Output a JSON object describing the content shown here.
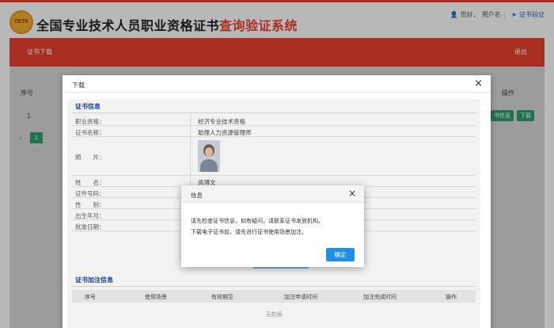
{
  "header": {
    "logo_text": "ПҞТК",
    "title_black": "全国专业技术人员职业资格证书",
    "title_red": "查询验证系统",
    "greeting": "您好，",
    "username": "用户名",
    "separator": "|",
    "verify_link": "证书验证"
  },
  "nav": {
    "left_item": "证书下载",
    "right_item": "退出"
  },
  "background_table": {
    "columns": [
      "序号",
      "操作"
    ],
    "row_number": "1",
    "buttons": [
      "书信息",
      "下载"
    ],
    "pager": {
      "prev": "‹",
      "current_page": "1"
    }
  },
  "dialog": {
    "title": "下载",
    "close": "×",
    "cert_section_title": "证书信息",
    "fields": [
      {
        "label": "职业资格：",
        "value": "经济专业技术资格"
      },
      {
        "label": "证书名称：",
        "value": "助理人力资源管理师"
      },
      {
        "label": "照　　片：",
        "value": ""
      },
      {
        "label": "姓　　名：",
        "value": "高博文"
      },
      {
        "label": "证件号码：",
        "value": ""
      },
      {
        "label": "性　　别：",
        "value": ""
      },
      {
        "label": "出生年月：",
        "value": ""
      },
      {
        "label": "批准日期：",
        "value": ""
      }
    ],
    "remark_section_title": "证书加注信息",
    "remark_columns": [
      "序号",
      "使用场景",
      "有效期至",
      "加注申请时间",
      "加注完成时间",
      "操作"
    ],
    "empty_text": "无数据"
  },
  "alert": {
    "title": "信息",
    "close": "×",
    "line1": "请先检查证书信息，如有疑问，请联系证书发放机构。",
    "line2": "下载电子证书前，请先进行证书使用场景加注。",
    "ok_label": "确定"
  },
  "colors": {
    "brand_red": "#e8402f",
    "confirm_blue": "#1e8fe6",
    "section_blue": "#1a3d8f",
    "table_green": "#2e9e71"
  }
}
